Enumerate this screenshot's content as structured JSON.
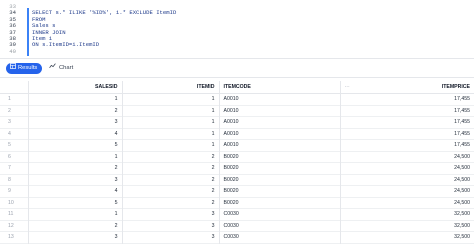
{
  "editor": {
    "lines": [
      {
        "num": "33",
        "code": ""
      },
      {
        "num": "34",
        "code": "SELECT s.* ILIKE '%ID%', i.* EXCLUDE ItemID"
      },
      {
        "num": "35",
        "code": "FROM"
      },
      {
        "num": "36",
        "code": "Sales s"
      },
      {
        "num": "37",
        "code": "INNER JOIN"
      },
      {
        "num": "38",
        "code": "Item i"
      },
      {
        "num": "39",
        "code": "ON s.ItemID=i.ItemID"
      },
      {
        "num": "40",
        "code": ""
      }
    ]
  },
  "tabs": {
    "results_label": "Results",
    "chart_label": "Chart"
  },
  "table": {
    "columns": [
      "SALESID",
      "ITEMID",
      "ITEMCODE",
      "ITEMPRICE"
    ],
    "header_menu": "···",
    "rows": [
      {
        "n": "1",
        "salesid": "1",
        "itemid": "1",
        "itemcode": "A0010",
        "itemprice": "17,455"
      },
      {
        "n": "2",
        "salesid": "2",
        "itemid": "1",
        "itemcode": "A0010",
        "itemprice": "17,455"
      },
      {
        "n": "3",
        "salesid": "3",
        "itemid": "1",
        "itemcode": "A0010",
        "itemprice": "17,455"
      },
      {
        "n": "4",
        "salesid": "4",
        "itemid": "1",
        "itemcode": "A0010",
        "itemprice": "17,455"
      },
      {
        "n": "5",
        "salesid": "5",
        "itemid": "1",
        "itemcode": "A0010",
        "itemprice": "17,455"
      },
      {
        "n": "6",
        "salesid": "1",
        "itemid": "2",
        "itemcode": "B0020",
        "itemprice": "24,500"
      },
      {
        "n": "7",
        "salesid": "2",
        "itemid": "2",
        "itemcode": "B0020",
        "itemprice": "24,500"
      },
      {
        "n": "8",
        "salesid": "3",
        "itemid": "2",
        "itemcode": "B0020",
        "itemprice": "24,500"
      },
      {
        "n": "9",
        "salesid": "4",
        "itemid": "2",
        "itemcode": "B0020",
        "itemprice": "24,500"
      },
      {
        "n": "10",
        "salesid": "5",
        "itemid": "2",
        "itemcode": "B0020",
        "itemprice": "24,500"
      },
      {
        "n": "11",
        "salesid": "1",
        "itemid": "3",
        "itemcode": "C0030",
        "itemprice": "32,500"
      },
      {
        "n": "12",
        "salesid": "2",
        "itemid": "3",
        "itemcode": "C0030",
        "itemprice": "32,500"
      },
      {
        "n": "13",
        "salesid": "3",
        "itemid": "3",
        "itemcode": "C0030",
        "itemprice": "32,500"
      }
    ]
  },
  "colors": {
    "accent": "#2563eb",
    "keyword": "#1e3a8a",
    "active_line_bar": "#3b82f6",
    "grid_line": "#e5e7eb"
  },
  "icons": {
    "results": "table-grid-icon",
    "chart": "line-chart-icon"
  }
}
